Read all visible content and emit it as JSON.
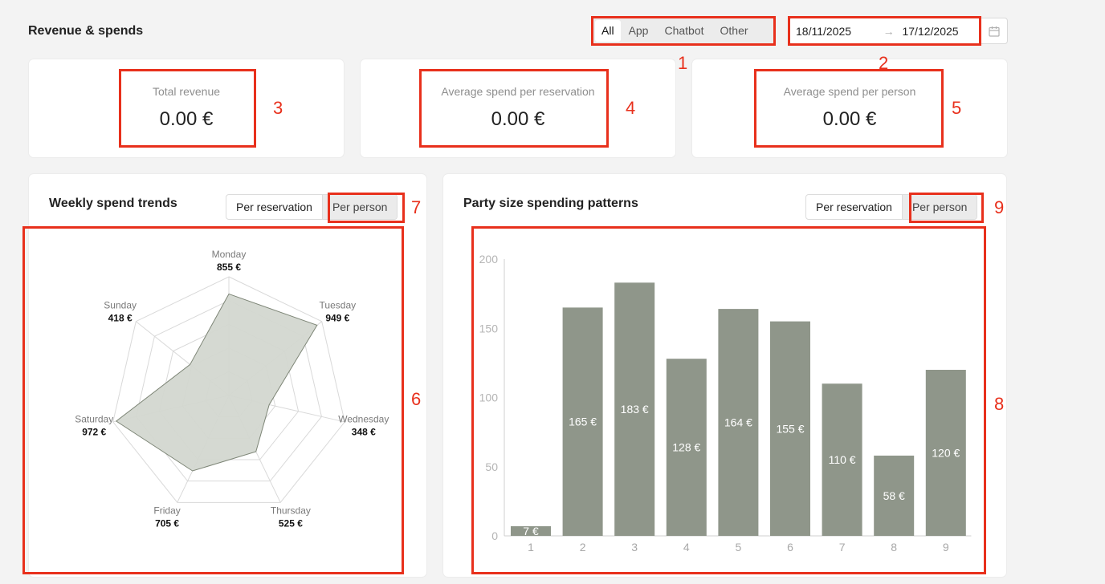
{
  "header": {
    "title": "Revenue & spends"
  },
  "channel_filter": {
    "options": [
      "All",
      "App",
      "Chatbot",
      "Other"
    ],
    "selected": "All"
  },
  "date_range": {
    "start": "18/11/2025",
    "separator": "→",
    "end": "17/12/2025",
    "icon": "calendar-icon"
  },
  "kpis": [
    {
      "label": "Total revenue",
      "value": "0.00 €"
    },
    {
      "label": "Average spend per reservation",
      "value": "0.00 €"
    },
    {
      "label": "Average spend per person",
      "value": "0.00 €"
    }
  ],
  "weekly": {
    "title": "Weekly spend trends",
    "toggle": [
      "Per reservation",
      "Per person"
    ],
    "selected": "Per person"
  },
  "party": {
    "title": "Party size spending patterns",
    "toggle": [
      "Per reservation",
      "Per person"
    ],
    "selected": "Per person"
  },
  "annotations": [
    "1",
    "2",
    "3",
    "4",
    "5",
    "6",
    "7",
    "8",
    "9"
  ],
  "colors": {
    "annotation": "#e8301c",
    "bar": "#8f968a",
    "radar_fill": "#d3d7d0",
    "radar_stroke": "#7d8576"
  },
  "chart_data": [
    {
      "type": "radar",
      "categories": [
        "Monday",
        "Tuesday",
        "Wednesday",
        "Thursday",
        "Friday",
        "Saturday",
        "Sunday"
      ],
      "values": [
        855,
        949,
        348,
        525,
        705,
        972,
        418
      ],
      "value_labels": [
        "855 €",
        "949 €",
        "348 €",
        "525 €",
        "705 €",
        "972 €",
        "418 €"
      ],
      "rmax": 1000,
      "rings": 5
    },
    {
      "type": "bar",
      "categories": [
        "1",
        "2",
        "3",
        "4",
        "5",
        "6",
        "7",
        "8",
        "9"
      ],
      "values": [
        7,
        165,
        183,
        128,
        164,
        155,
        110,
        58,
        120
      ],
      "value_labels": [
        "7 €",
        "165 €",
        "183 €",
        "128 €",
        "164 €",
        "155 €",
        "110 €",
        "58 €",
        "120 €"
      ],
      "yticks": [
        "0",
        "50",
        "100",
        "150",
        "200"
      ],
      "ylim": [
        0,
        200
      ]
    }
  ]
}
